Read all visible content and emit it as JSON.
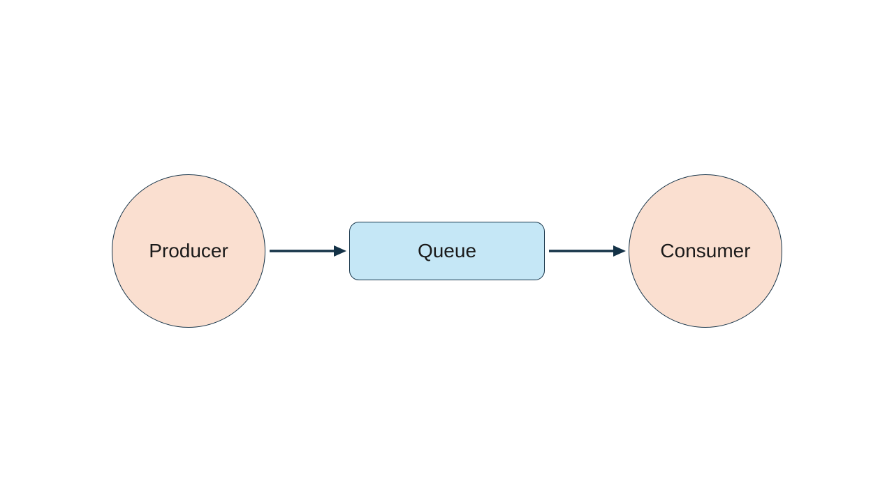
{
  "diagram": {
    "nodes": {
      "producer": {
        "label": "Producer",
        "shape": "circle",
        "fill": "#fadfd0",
        "stroke": "#143247"
      },
      "queue": {
        "label": "Queue",
        "shape": "rounded-rect",
        "fill": "#c5e7f6",
        "stroke": "#143247"
      },
      "consumer": {
        "label": "Consumer",
        "shape": "circle",
        "fill": "#fadfd0",
        "stroke": "#143247"
      }
    },
    "edges": [
      {
        "from": "producer",
        "to": "queue",
        "style": "arrow"
      },
      {
        "from": "queue",
        "to": "consumer",
        "style": "arrow"
      }
    ],
    "arrow_color": "#143247"
  }
}
